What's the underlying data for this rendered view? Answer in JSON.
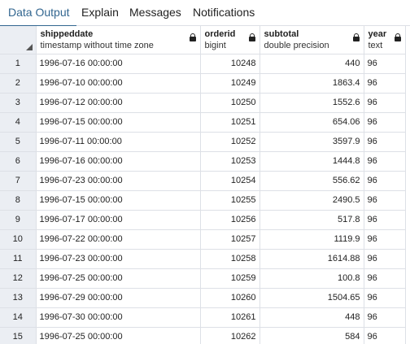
{
  "tabs": [
    {
      "label": "Data Output",
      "active": true
    },
    {
      "label": "Explain",
      "active": false
    },
    {
      "label": "Messages",
      "active": false
    },
    {
      "label": "Notifications",
      "active": false
    }
  ],
  "columns": [
    {
      "name": "shippeddate",
      "type": "timestamp without time zone"
    },
    {
      "name": "orderid",
      "type": "bigint"
    },
    {
      "name": "subtotal",
      "type": "double precision"
    },
    {
      "name": "year",
      "type": "text"
    }
  ],
  "rows": [
    {
      "n": "1",
      "shippeddate": "1996-07-16 00:00:00",
      "orderid": "10248",
      "subtotal": "440",
      "year": "96"
    },
    {
      "n": "2",
      "shippeddate": "1996-07-10 00:00:00",
      "orderid": "10249",
      "subtotal": "1863.4",
      "year": "96"
    },
    {
      "n": "3",
      "shippeddate": "1996-07-12 00:00:00",
      "orderid": "10250",
      "subtotal": "1552.6",
      "year": "96"
    },
    {
      "n": "4",
      "shippeddate": "1996-07-15 00:00:00",
      "orderid": "10251",
      "subtotal": "654.06",
      "year": "96"
    },
    {
      "n": "5",
      "shippeddate": "1996-07-11 00:00:00",
      "orderid": "10252",
      "subtotal": "3597.9",
      "year": "96"
    },
    {
      "n": "6",
      "shippeddate": "1996-07-16 00:00:00",
      "orderid": "10253",
      "subtotal": "1444.8",
      "year": "96"
    },
    {
      "n": "7",
      "shippeddate": "1996-07-23 00:00:00",
      "orderid": "10254",
      "subtotal": "556.62",
      "year": "96"
    },
    {
      "n": "8",
      "shippeddate": "1996-07-15 00:00:00",
      "orderid": "10255",
      "subtotal": "2490.5",
      "year": "96"
    },
    {
      "n": "9",
      "shippeddate": "1996-07-17 00:00:00",
      "orderid": "10256",
      "subtotal": "517.8",
      "year": "96"
    },
    {
      "n": "10",
      "shippeddate": "1996-07-22 00:00:00",
      "orderid": "10257",
      "subtotal": "1119.9",
      "year": "96"
    },
    {
      "n": "11",
      "shippeddate": "1996-07-23 00:00:00",
      "orderid": "10258",
      "subtotal": "1614.88",
      "year": "96"
    },
    {
      "n": "12",
      "shippeddate": "1996-07-25 00:00:00",
      "orderid": "10259",
      "subtotal": "100.8",
      "year": "96"
    },
    {
      "n": "13",
      "shippeddate": "1996-07-29 00:00:00",
      "orderid": "10260",
      "subtotal": "1504.65",
      "year": "96"
    },
    {
      "n": "14",
      "shippeddate": "1996-07-30 00:00:00",
      "orderid": "10261",
      "subtotal": "448",
      "year": "96"
    },
    {
      "n": "15",
      "shippeddate": "1996-07-25 00:00:00",
      "orderid": "10262",
      "subtotal": "584",
      "year": "96"
    }
  ],
  "icons": {
    "lock": "lock-icon",
    "corner": "select-all-corner-icon"
  },
  "colors": {
    "accent": "#326690",
    "header_bg": "#ebeef3",
    "border": "#dde0e6"
  }
}
